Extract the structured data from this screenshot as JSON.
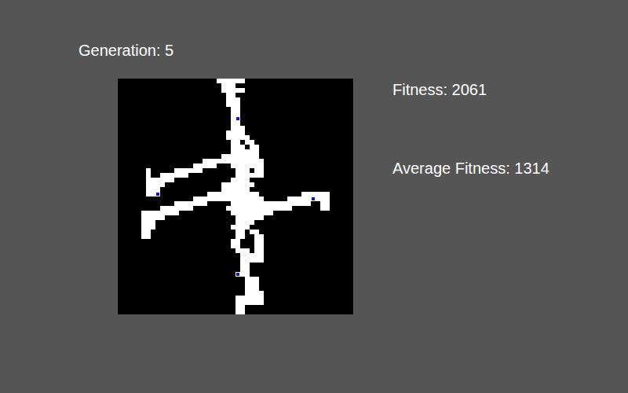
{
  "generation": "Generation: 5",
  "fitness": "Fitness: 2061",
  "average_fitness": "Average Fitness: 1314",
  "world": {
    "grid": 50,
    "runs": [
      [
        0,
        21,
        26
      ],
      [
        1,
        22,
        24
      ],
      [
        2,
        22,
        26
      ],
      [
        3,
        23,
        24
      ],
      [
        4,
        23,
        25
      ],
      [
        5,
        23,
        25
      ],
      [
        6,
        24,
        25
      ],
      [
        7,
        24,
        25
      ],
      [
        8,
        24,
        25
      ],
      [
        9,
        24,
        25
      ],
      [
        10,
        24,
        26
      ],
      [
        11,
        23,
        26
      ],
      [
        12,
        23,
        27
      ],
      [
        13,
        24,
        25
      ],
      [
        13,
        27,
        28
      ],
      [
        14,
        24,
        26
      ],
      [
        14,
        28,
        29
      ],
      [
        15,
        24,
        27
      ],
      [
        15,
        28,
        29
      ],
      [
        16,
        22,
        29
      ],
      [
        17,
        18,
        30
      ],
      [
        18,
        16,
        20
      ],
      [
        18,
        24,
        30
      ],
      [
        19,
        6,
        6
      ],
      [
        19,
        12,
        17
      ],
      [
        19,
        25,
        27
      ],
      [
        19,
        29,
        30
      ],
      [
        20,
        6,
        6
      ],
      [
        20,
        9,
        14
      ],
      [
        20,
        25,
        30
      ],
      [
        21,
        6,
        11
      ],
      [
        21,
        24,
        27
      ],
      [
        22,
        6,
        9
      ],
      [
        22,
        22,
        28
      ],
      [
        23,
        6,
        8
      ],
      [
        23,
        22,
        27
      ],
      [
        24,
        6,
        8
      ],
      [
        24,
        19,
        29
      ],
      [
        24,
        39,
        44
      ],
      [
        25,
        16,
        30
      ],
      [
        25,
        36,
        44
      ],
      [
        26,
        12,
        18
      ],
      [
        26,
        24,
        40
      ],
      [
        26,
        43,
        44
      ],
      [
        27,
        9,
        15
      ],
      [
        27,
        23,
        36
      ],
      [
        27,
        43,
        44
      ],
      [
        28,
        5,
        12
      ],
      [
        28,
        24,
        32
      ],
      [
        29,
        5,
        9
      ],
      [
        29,
        25,
        30
      ],
      [
        30,
        5,
        7
      ],
      [
        30,
        25,
        28
      ],
      [
        31,
        5,
        7
      ],
      [
        31,
        24,
        27
      ],
      [
        32,
        5,
        6
      ],
      [
        32,
        25,
        26
      ],
      [
        32,
        28,
        29
      ],
      [
        33,
        5,
        6
      ],
      [
        33,
        25,
        26
      ],
      [
        33,
        29,
        30
      ],
      [
        34,
        24,
        25
      ],
      [
        34,
        29,
        30
      ],
      [
        35,
        24,
        25
      ],
      [
        35,
        29,
        30
      ],
      [
        36,
        25,
        27
      ],
      [
        36,
        29,
        30
      ],
      [
        37,
        26,
        30
      ],
      [
        38,
        26,
        30
      ],
      [
        39,
        26,
        27
      ],
      [
        40,
        26,
        27
      ],
      [
        41,
        25,
        27
      ],
      [
        42,
        27,
        29
      ],
      [
        43,
        27,
        29
      ],
      [
        44,
        27,
        29
      ],
      [
        45,
        27,
        30
      ],
      [
        46,
        25,
        30
      ],
      [
        47,
        25,
        30
      ],
      [
        48,
        25,
        26
      ],
      [
        49,
        25,
        26
      ]
    ],
    "agents": [
      {
        "cell": [
          25,
          8
        ]
      },
      {
        "cell": [
          8,
          24
        ]
      },
      {
        "cell": [
          41,
          25
        ]
      },
      {
        "cell": [
          25,
          41
        ]
      }
    ]
  }
}
